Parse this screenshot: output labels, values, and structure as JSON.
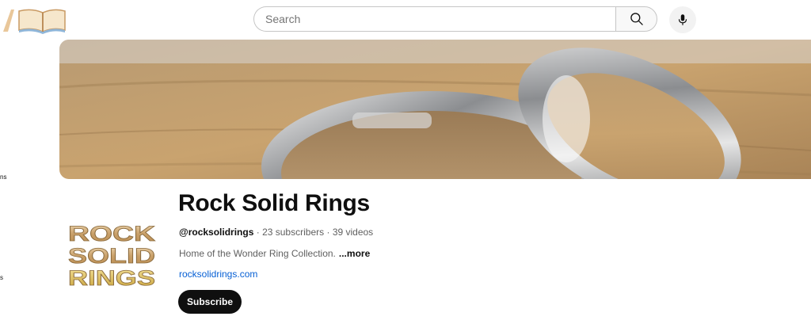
{
  "header": {
    "logo_icon": "open-book-icon",
    "search": {
      "placeholder": "Search",
      "value": ""
    },
    "search_icon": "search-icon",
    "mic_icon": "microphone-icon"
  },
  "sidebar": {
    "fragments": [
      "ns",
      "s"
    ]
  },
  "banner": {
    "description": "two silver rings on wooden surface"
  },
  "channel": {
    "avatar_logo_text": [
      "ROCK",
      "SOLID",
      "RINGS"
    ],
    "name": "Rock Solid Rings",
    "handle": "@rocksolidrings",
    "subscribers": "23 subscribers",
    "videos": "39 videos",
    "separator": "·",
    "description": "Home of the Wonder Ring Collection.",
    "more_label": "...more",
    "link": "rocksolidrings.com",
    "subscribe_label": "Subscribe"
  },
  "colors": {
    "link": "#065fd4",
    "subscribe_bg": "#0f0f0f",
    "meta_text": "#606060"
  }
}
